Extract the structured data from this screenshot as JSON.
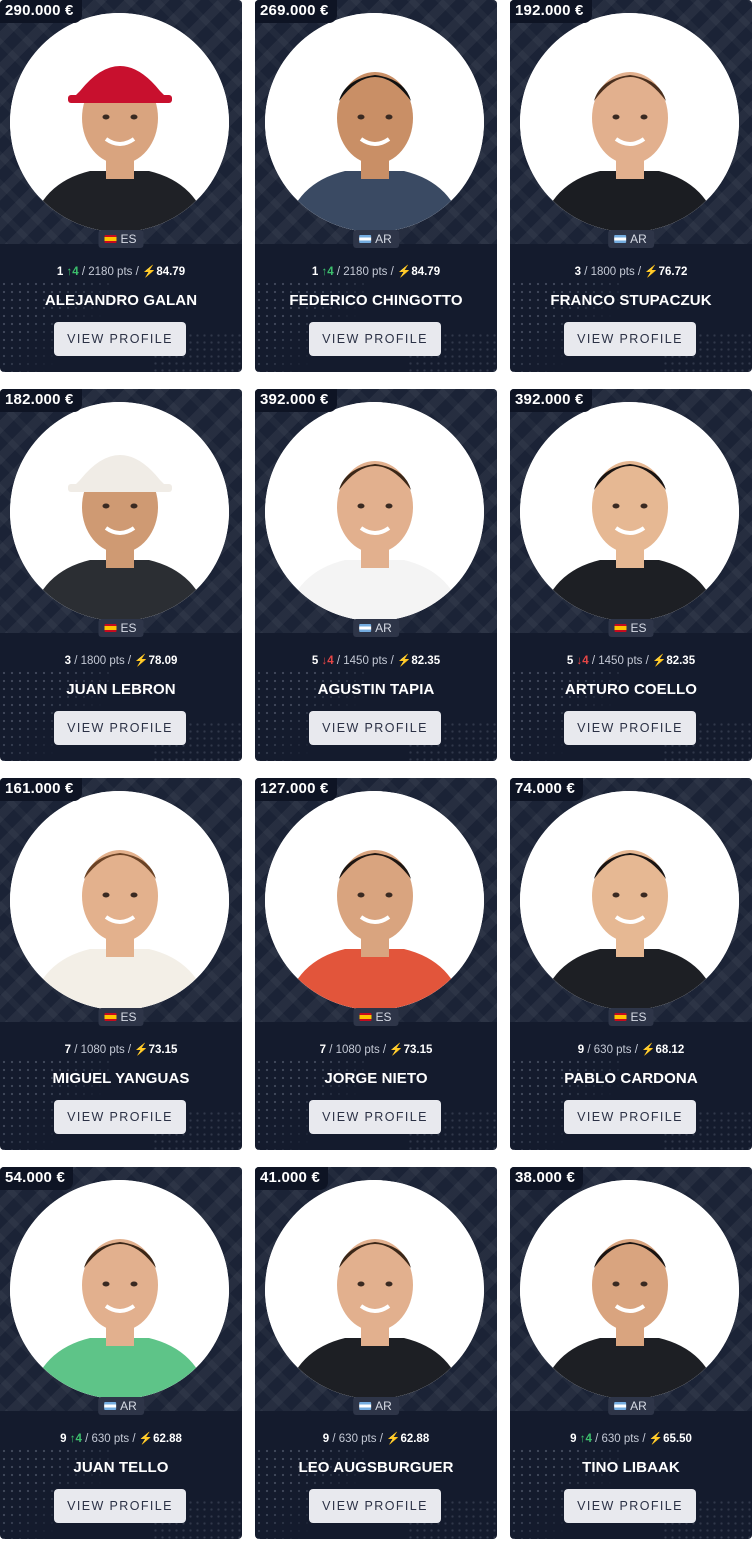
{
  "cards": [
    {
      "price": "290.000 €",
      "country": "ES",
      "rank": "1",
      "delta": "4",
      "delta_dir": "up",
      "points": "/ 2180 pts /",
      "score": "84.79",
      "name": "ALEJANDRO GALAN",
      "button": "VIEW PROFILE",
      "shirt": "#1f2126",
      "skin": "#d9a47f",
      "hair": "#2a1d16",
      "cap": "#c8102e"
    },
    {
      "price": "269.000 €",
      "country": "AR",
      "rank": "1",
      "delta": "4",
      "delta_dir": "up",
      "points": "/ 2180 pts /",
      "score": "84.79",
      "name": "FEDERICO CHINGOTTO",
      "button": "VIEW PROFILE",
      "shirt": "#3a4a63",
      "skin": "#c98f66",
      "hair": "#111111",
      "cap": ""
    },
    {
      "price": "192.000 €",
      "country": "AR",
      "rank": "3",
      "delta": "",
      "delta_dir": "",
      "points": "/ 1800 pts /",
      "score": "76.72",
      "name": "FRANCO STUPACZUK",
      "button": "VIEW PROFILE",
      "shirt": "#1b1d22",
      "skin": "#e2b08e",
      "hair": "#4a2f1e",
      "cap": ""
    },
    {
      "price": "182.000 €",
      "country": "ES",
      "rank": "3",
      "delta": "",
      "delta_dir": "",
      "points": "/ 1800 pts /",
      "score": "78.09",
      "name": "JUAN LEBRON",
      "button": "VIEW PROFILE",
      "shirt": "#2b2e33",
      "skin": "#cf9a73",
      "hair": "#2a1d16",
      "cap": "#f0ece6"
    },
    {
      "price": "392.000 €",
      "country": "AR",
      "rank": "5",
      "delta": "4",
      "delta_dir": "down",
      "points": "/ 1450 pts /",
      "score": "82.35",
      "name": "AGUSTIN TAPIA",
      "button": "VIEW PROFILE",
      "shirt": "#f4f4f4",
      "skin": "#e2b08e",
      "hair": "#3b2718",
      "cap": ""
    },
    {
      "price": "392.000 €",
      "country": "ES",
      "rank": "5",
      "delta": "4",
      "delta_dir": "down",
      "points": "/ 1450 pts /",
      "score": "82.35",
      "name": "ARTURO COELLO",
      "button": "VIEW PROFILE",
      "shirt": "#1d1f24",
      "skin": "#e6b893",
      "hair": "#1a1412",
      "cap": ""
    },
    {
      "price": "161.000 €",
      "country": "ES",
      "rank": "7",
      "delta": "",
      "delta_dir": "",
      "points": "/ 1080 pts /",
      "score": "73.15",
      "name": "MIGUEL YANGUAS",
      "button": "VIEW PROFILE",
      "shirt": "#f3efe7",
      "skin": "#e3b18d",
      "hair": "#6b4326",
      "cap": ""
    },
    {
      "price": "127.000 €",
      "country": "ES",
      "rank": "7",
      "delta": "",
      "delta_dir": "",
      "points": "/ 1080 pts /",
      "score": "73.15",
      "name": "JORGE NIETO",
      "button": "VIEW PROFILE",
      "shirt": "#e2553b",
      "skin": "#d9a47f",
      "hair": "#1e1612",
      "cap": ""
    },
    {
      "price": "74.000 €",
      "country": "ES",
      "rank": "9",
      "delta": "",
      "delta_dir": "",
      "points": "/ 630 pts /",
      "score": "68.12",
      "name": "PABLO CARDONA",
      "button": "VIEW PROFILE",
      "shirt": "#1d1f24",
      "skin": "#e6b893",
      "hair": "#1a1412",
      "cap": ""
    },
    {
      "price": "54.000 €",
      "country": "AR",
      "rank": "9",
      "delta": "4",
      "delta_dir": "up",
      "points": "/ 630 pts /",
      "score": "62.88",
      "name": "JUAN TELLO",
      "button": "VIEW PROFILE",
      "shirt": "#5ec488",
      "skin": "#e2b08e",
      "hair": "#3b2718",
      "cap": ""
    },
    {
      "price": "41.000 €",
      "country": "AR",
      "rank": "9",
      "delta": "",
      "delta_dir": "",
      "points": "/ 630 pts /",
      "score": "62.88",
      "name": "LEO AUGSBURGUER",
      "button": "VIEW PROFILE",
      "shirt": "#1d1f24",
      "skin": "#e2b08e",
      "hair": "#3b2718",
      "cap": ""
    },
    {
      "price": "38.000 €",
      "country": "AR",
      "rank": "9",
      "delta": "4",
      "delta_dir": "up",
      "points": "/ 630 pts /",
      "score": "65.50",
      "name": "TINO LIBAAK",
      "button": "VIEW PROFILE",
      "shirt": "#1d1f24",
      "skin": "#d9a47f",
      "hair": "#1a1412",
      "cap": ""
    }
  ]
}
